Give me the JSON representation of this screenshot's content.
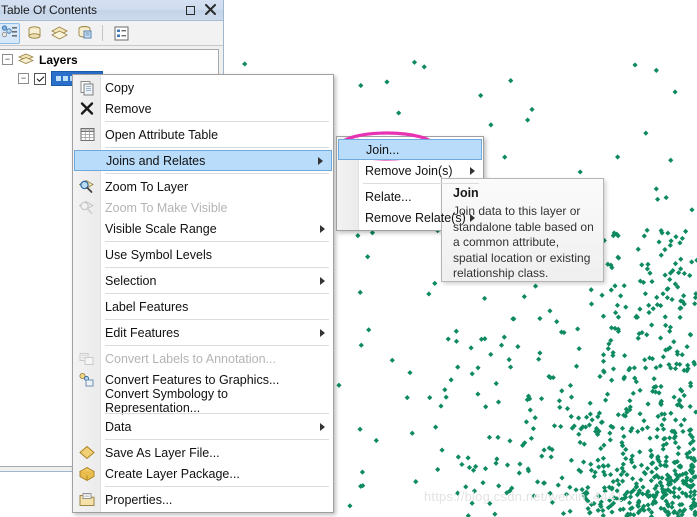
{
  "window": {
    "title": "Table Of Contents",
    "buttons": [
      {
        "name": "maximize-button",
        "icon": "maximize-icon"
      },
      {
        "name": "close-button",
        "icon": "close-icon",
        "label": "✕"
      }
    ]
  },
  "toolbar": {
    "items": [
      {
        "name": "list-by-drawing-order-button",
        "icon": "drawing-order-icon",
        "active": true
      },
      {
        "name": "list-by-source-button",
        "icon": "source-icon",
        "active": false
      },
      {
        "name": "list-by-visibility-button",
        "icon": "visibility-icon",
        "active": false
      },
      {
        "name": "list-by-selection-button",
        "icon": "selection-icon",
        "active": false
      },
      {
        "name": "options-button",
        "icon": "options-list-icon",
        "active": false
      }
    ]
  },
  "tree": {
    "root_label": "Layers",
    "root_expander": "−",
    "child_expander": "−",
    "child_checked": true,
    "child_label": ""
  },
  "collapse_button": {
    "icon": "chevron-left-icon"
  },
  "context_menu": {
    "items": [
      {
        "label": "Copy",
        "icon": "copy-icon",
        "disabled": false,
        "submenu": false,
        "selected": false,
        "sep_after": false
      },
      {
        "label": "Remove",
        "icon": "remove-x-icon",
        "disabled": false,
        "submenu": false,
        "selected": false,
        "sep_after": true
      },
      {
        "label": "Open Attribute Table",
        "icon": "table-icon",
        "disabled": false,
        "submenu": false,
        "selected": false,
        "sep_after": true
      },
      {
        "label": "Joins and Relates",
        "icon": "",
        "disabled": false,
        "submenu": true,
        "selected": true,
        "sep_after": true
      },
      {
        "label": "Zoom To Layer",
        "icon": "zoom-layer-icon",
        "disabled": false,
        "submenu": false,
        "selected": false,
        "sep_after": false
      },
      {
        "label": "Zoom To Make Visible",
        "icon": "zoom-visible-icon",
        "disabled": true,
        "submenu": false,
        "selected": false,
        "sep_after": false
      },
      {
        "label": "Visible Scale Range",
        "icon": "",
        "disabled": false,
        "submenu": true,
        "selected": false,
        "sep_after": true
      },
      {
        "label": "Use Symbol Levels",
        "icon": "",
        "disabled": false,
        "submenu": false,
        "selected": false,
        "sep_after": true
      },
      {
        "label": "Selection",
        "icon": "",
        "disabled": false,
        "submenu": true,
        "selected": false,
        "sep_after": true
      },
      {
        "label": "Label Features",
        "icon": "",
        "disabled": false,
        "submenu": false,
        "selected": false,
        "sep_after": true
      },
      {
        "label": "Edit Features",
        "icon": "",
        "disabled": false,
        "submenu": true,
        "selected": false,
        "sep_after": true
      },
      {
        "label": "Convert Labels to Annotation...",
        "icon": "convert-labels-icon",
        "disabled": true,
        "submenu": false,
        "selected": false,
        "sep_after": false
      },
      {
        "label": "Convert Features to Graphics...",
        "icon": "convert-features-icon",
        "disabled": false,
        "submenu": false,
        "selected": false,
        "sep_after": false
      },
      {
        "label": "Convert Symbology to Representation...",
        "icon": "",
        "disabled": false,
        "submenu": false,
        "selected": false,
        "sep_after": true
      },
      {
        "label": "Data",
        "icon": "",
        "disabled": false,
        "submenu": true,
        "selected": false,
        "sep_after": true
      },
      {
        "label": "Save As Layer File...",
        "icon": "layer-file-icon",
        "disabled": false,
        "submenu": false,
        "selected": false,
        "sep_after": false
      },
      {
        "label": "Create Layer Package...",
        "icon": "layer-package-icon",
        "disabled": false,
        "submenu": false,
        "selected": false,
        "sep_after": true
      },
      {
        "label": "Properties...",
        "icon": "properties-icon",
        "disabled": false,
        "submenu": false,
        "selected": false,
        "sep_after": false
      }
    ]
  },
  "submenu": {
    "items": [
      {
        "label": "Join...",
        "disabled": false,
        "submenu": false,
        "selected": true,
        "sep_after": false
      },
      {
        "label": "Remove Join(s)",
        "disabled": false,
        "submenu": true,
        "selected": false,
        "sep_after": true
      },
      {
        "label": "Relate...",
        "disabled": false,
        "submenu": false,
        "selected": false,
        "sep_after": false
      },
      {
        "label": "Remove Relate(s)",
        "disabled": false,
        "submenu": true,
        "selected": false,
        "sep_after": false
      }
    ]
  },
  "tooltip": {
    "title": "Join",
    "body": "Join data to this layer or standalone table based on a common attribute, spatial location or existing relationship class."
  },
  "annotation": {
    "shape": "ellipse",
    "color": "#E832B4",
    "target": "Join..."
  },
  "watermark": {
    "text": "https://blog.csdn.net/weixin_4441",
    "faded_text": ""
  },
  "map": {
    "background": "#ffffff",
    "point_color": "#0E8A5F",
    "point_shape": "diamond"
  }
}
